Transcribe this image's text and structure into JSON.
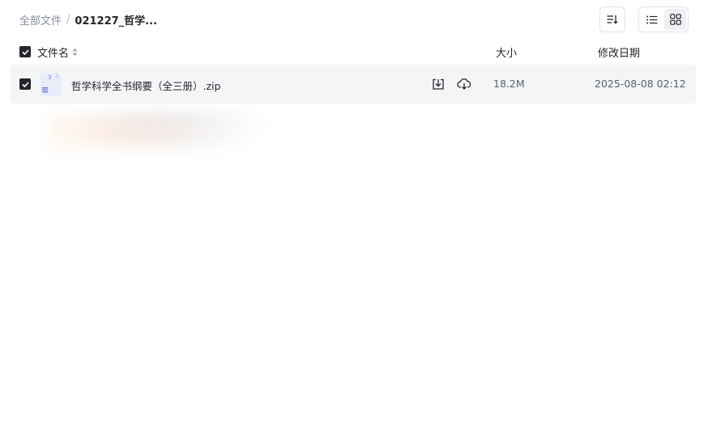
{
  "breadcrumb": {
    "root": "全部文件",
    "separator": "/",
    "current": "021227_哲学..."
  },
  "toolbar": {
    "sort_icon": "sort-icon",
    "view_modes": [
      "list-view-icon",
      "grid-view-icon"
    ]
  },
  "table": {
    "columns": {
      "name": "文件名",
      "size": "大小",
      "date": "修改日期"
    },
    "rows": [
      {
        "name": "哲学科学全书纲要（全三册）.zip",
        "size": "18.2M",
        "modified": "2025-08-08 02:12",
        "checked": true,
        "actions": [
          "download-icon",
          "cloud-save-icon"
        ]
      }
    ]
  },
  "colors": {
    "text_primary": "#25262b",
    "text_secondary": "#878c9c",
    "row_bg": "#f4f5f7",
    "checkbox": "#25262b"
  }
}
